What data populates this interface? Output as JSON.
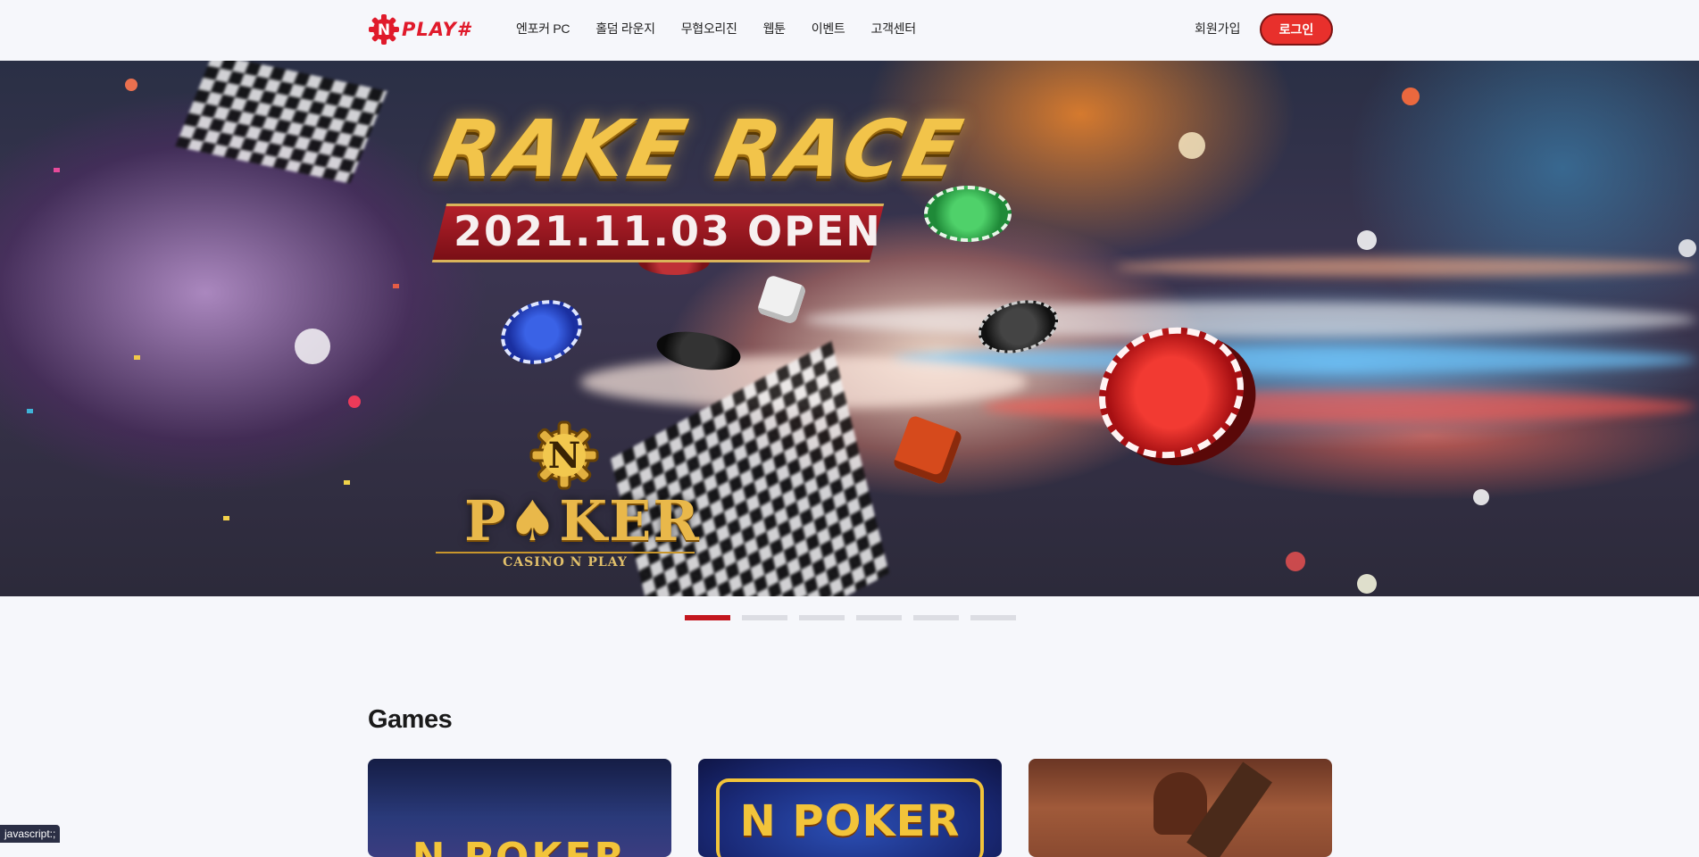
{
  "header": {
    "logo_text": "PLAY#",
    "logo_letter": "N",
    "nav": [
      "엔포커 PC",
      "홀덤 라운지",
      "무협오리진",
      "웹툰",
      "이벤트",
      "고객센터"
    ],
    "signup_label": "회원가입",
    "login_label": "로그인"
  },
  "banner": {
    "title": "RAKE RACE",
    "date_text": "2021.11.03 OPEN",
    "logo_letter": "N",
    "logo_word": "P♠KER",
    "logo_sub": "CASINO N PLAY"
  },
  "pager": {
    "count": 6,
    "active_index": 0
  },
  "games": {
    "title": "Games",
    "cards": [
      {
        "name": "N POKER"
      },
      {
        "name": "N POKER"
      },
      {
        "name": ""
      }
    ]
  },
  "status_bar": "javascript:;",
  "colors": {
    "accent": "#e8302c",
    "pager_active": "#c3161e",
    "background": "#f6f7fb"
  }
}
